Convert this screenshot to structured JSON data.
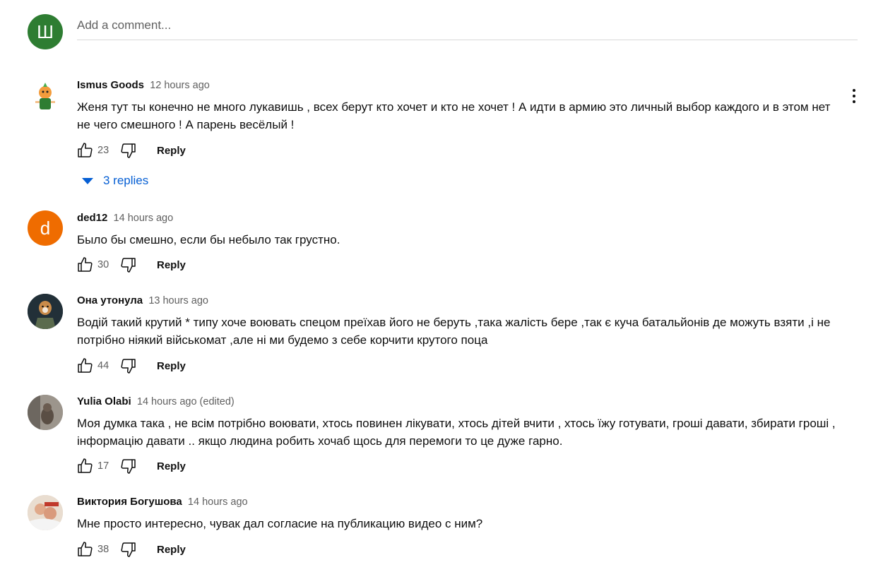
{
  "add_comment": {
    "avatar_letter": "Ш",
    "avatar_color": "#2e7d32",
    "placeholder": "Add a comment..."
  },
  "comments": [
    {
      "author": "Ismus Goods",
      "time": "12 hours ago",
      "text": "Женя тут ты конечно не много лукавишь , всех берут кто хочет и кто не хочет ! А идти в армию это личный выбор каждого и в этом нет не чего смешного !  А парень весёлый !",
      "likes": "23",
      "reply_label": "Reply",
      "replies_label": "3 replies",
      "avatar_icon": "onion-character-avatar"
    },
    {
      "author": "ded12",
      "time": "14 hours ago",
      "text": "Было бы смешно, если бы небыло так грустно.",
      "likes": "30",
      "reply_label": "Reply",
      "avatar_letter": "d",
      "avatar_color": "#ef6c00"
    },
    {
      "author": "Она утонула",
      "time": "13 hours ago",
      "text": "Водій такий крутий * типу хоче  воювать спецом преїхав його не беруть ,така жалість бере ,так є куча батальйонів де можуть взяти ,і не потрібно ніякий військомат  ,але ні ми будемо з себе корчити крутого поца",
      "likes": "44",
      "reply_label": "Reply",
      "avatar_icon": "dog-soldier-avatar"
    },
    {
      "author": "Yulia Olabi",
      "time": "14 hours ago (edited)",
      "text": "Моя думка така , не всім потрібно воювати, хтось повинен лікувати, хтось дітей вчити , хтось їжу готувати, гроші давати, збирати гроші , інформацію давати .. якщо людина робить хочаб щось для перемоги то це дуже гарно.",
      "likes": "17",
      "reply_label": "Reply",
      "avatar_icon": "cat-photo-avatar"
    },
    {
      "author": "Виктория Богушова",
      "time": "14 hours ago",
      "text": "Мне просто интересно, чувак дал согласие на публикацию видео с ним?",
      "likes": "38",
      "reply_label": "Reply",
      "avatar_icon": "family-photo-avatar"
    }
  ]
}
